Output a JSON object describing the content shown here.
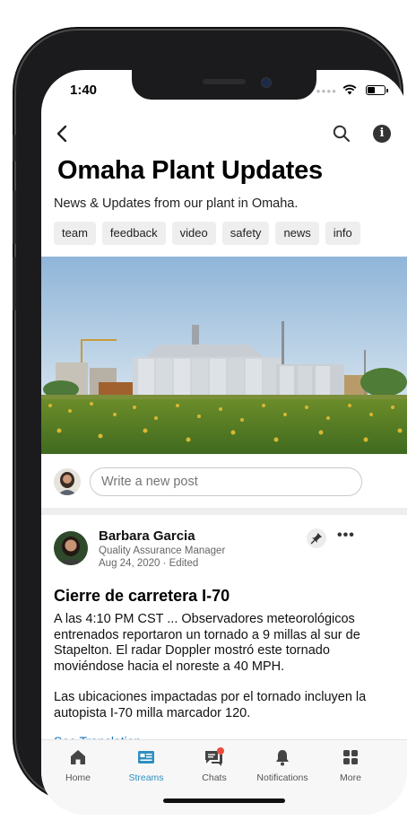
{
  "status": {
    "time": "1:40"
  },
  "group": {
    "title": "Omaha Plant Updates",
    "subtitle": "News & Updates from our plant in Omaha.",
    "tags": [
      "team",
      "feedback",
      "video",
      "safety",
      "news",
      "info"
    ]
  },
  "composer": {
    "placeholder": "Write a new post"
  },
  "post": {
    "author": "Barbara Garcia",
    "role": "Quality Assurance Manager",
    "date": "Aug 24, 2020 · Edited",
    "more": "•••",
    "title": "Cierre de carretera I-70",
    "paragraphs": [
      "A las 4:10 PM CST ... Observadores meteorológicos entrenados reportaron un tornado a 9 millas al sur de Stapelton. El radar Doppler mostró este tornado moviéndose hacia el noreste a 40 MPH.",
      "Las ubicaciones impactadas por el tornado incluyen la autopista I-70 milla marcador 120."
    ],
    "see_translation": "See Translation"
  },
  "tabs": [
    {
      "label": "Home",
      "icon": "home-icon"
    },
    {
      "label": "Streams",
      "icon": "streams-icon",
      "active": true
    },
    {
      "label": "Chats",
      "icon": "chats-icon",
      "badge": true
    },
    {
      "label": "Notifications",
      "icon": "bell-icon"
    },
    {
      "label": "More",
      "icon": "grid-icon"
    }
  ],
  "colors": {
    "accent": "#2f8fbf",
    "badge": "#e84c3d"
  }
}
